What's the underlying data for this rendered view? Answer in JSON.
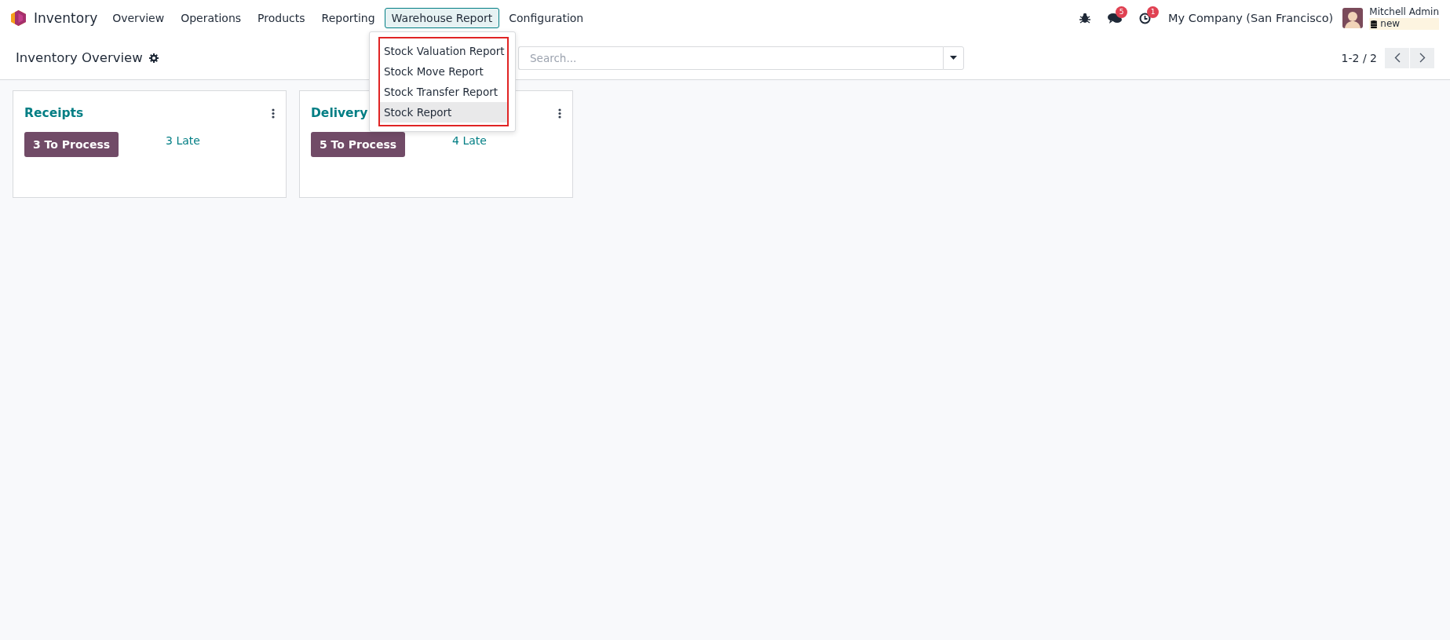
{
  "app": {
    "name": "Inventory"
  },
  "menu": [
    {
      "label": "Overview",
      "selected": false
    },
    {
      "label": "Operations",
      "selected": false
    },
    {
      "label": "Products",
      "selected": false
    },
    {
      "label": "Reporting",
      "selected": false
    },
    {
      "label": "Warehouse Report",
      "selected": true
    },
    {
      "label": "Configuration",
      "selected": false
    }
  ],
  "dropdown": {
    "items": [
      {
        "label": "Stock Valuation Report",
        "highlighted": false
      },
      {
        "label": "Stock Move Report",
        "highlighted": false
      },
      {
        "label": "Stock Transfer Report",
        "highlighted": false
      },
      {
        "label": "Stock Report",
        "highlighted": true
      }
    ]
  },
  "systray": {
    "messages_count": "5",
    "activities_count": "1",
    "company": "My Company (San Francisco)",
    "user_name": "Mitchell Admin",
    "database": "new"
  },
  "control_panel": {
    "title": "Inventory Overview",
    "search": {
      "placeholder": "Search..."
    },
    "pager": "1-2 / 2"
  },
  "cards": [
    {
      "title": "Receipts",
      "action": "3 To Process",
      "late": "3 Late"
    },
    {
      "title": "Delivery",
      "action": "5 To Process",
      "late": "4 Late"
    }
  ]
}
